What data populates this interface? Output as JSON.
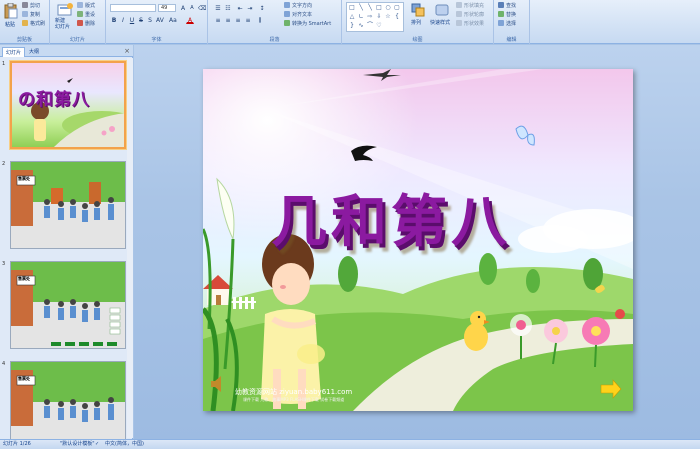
{
  "ribbon": {
    "clipboard": {
      "paste_label": "粘贴",
      "cut_label": "剪切",
      "copy_label": "复制",
      "format_painter_label": "格式刷",
      "group_label": "剪贴板"
    },
    "slides": {
      "new_slide_label": "新建\n幻灯片",
      "layout_label": "版式",
      "reset_label": "重设",
      "delete_label": "删除",
      "group_label": "幻灯片"
    },
    "font": {
      "size_value": "49",
      "group_label": "字体"
    },
    "paragraph": {
      "text_direction_label": "文字方向",
      "align_text_label": "对齐文本",
      "smartart_label": "转换为 SmartArt",
      "group_label": "段落"
    },
    "drawing": {
      "arrange_label": "排列",
      "quick_styles_label": "快速样式",
      "shape_fill_label": "形状填充",
      "shape_outline_label": "形状轮廓",
      "shape_effects_label": "形状效果",
      "group_label": "绘图"
    },
    "editing": {
      "find_label": "查找",
      "replace_label": "替换",
      "select_label": "选择",
      "group_label": "编辑"
    }
  },
  "left_panel": {
    "tabs": [
      {
        "label": "幻灯片"
      },
      {
        "label": "大纲"
      }
    ],
    "close_glyph": "×",
    "thumbnails": [
      {
        "number": "1",
        "title": "の和第八"
      },
      {
        "number": "2",
        "sign": "售票处"
      },
      {
        "number": "3",
        "sign": "售票处"
      },
      {
        "number": "4",
        "sign": "售票处"
      }
    ]
  },
  "slide": {
    "title": "几和第八",
    "watermark": "幼教资源网站  ziyuan.baby611.com",
    "watermark_sub": "课件下载   儿歌、故事MP3   FLASH课件下载   试卷下载频道"
  },
  "statusbar": {
    "slide_info": "幻灯片 1/26",
    "theme": "\"默认设计模板\"",
    "language": "中文(简体，中国)"
  },
  "colors": {
    "title": "#8b1aa0",
    "ribbon_bg": "#d3e2f5",
    "canvas_bg": "#a9c4e6",
    "selected_border": "#f3a24b"
  }
}
